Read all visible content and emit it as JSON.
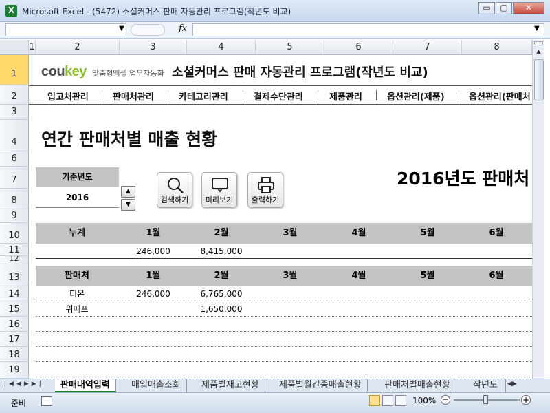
{
  "window": {
    "title": "Microsoft Excel - (5472) 소셜커머스 판매 자동관리 프로그램(작년도 비교)",
    "icon": "X",
    "minimize": "▭",
    "restore": "▢",
    "close": "✕"
  },
  "formula_bar": {
    "fx": "fx"
  },
  "columns": [
    "1",
    "2",
    "3",
    "4",
    "5",
    "6",
    "7",
    "8"
  ],
  "rows": [
    "1",
    "2",
    "3",
    "4",
    "6",
    "7",
    "8",
    "9",
    "10",
    "11",
    "12",
    "13",
    "14",
    "15",
    "16",
    "17",
    "18",
    "19"
  ],
  "brand": {
    "cou": "cou",
    "key": "key",
    "sub": "맞춤형엑셀 업무자동화"
  },
  "app_title": "소셜커머스 판매 자동관리 프로그램(작년도 비교)",
  "nav": [
    "입고처관리",
    "판매처관리",
    "카테고리관리",
    "결제수단관리",
    "제품관리",
    "옵션관리(제품)",
    "옵션관리(판매처"
  ],
  "page_title": "연간 판매처별 매출 현황",
  "year": {
    "label": "기준년도",
    "value": "2016",
    "up": "▲",
    "down": "▼"
  },
  "buttons": {
    "search": "검색하기",
    "preview": "미리보기",
    "print": "출력하기"
  },
  "report_title": "2016년도 판매처",
  "summary": {
    "headers": [
      "누계",
      "1월",
      "2월",
      "3월",
      "4월",
      "5월",
      "6월"
    ],
    "values": [
      "",
      "246,000",
      "8,415,000",
      "",
      "",
      "",
      ""
    ]
  },
  "detail": {
    "headers": [
      "판매처",
      "1월",
      "2월",
      "3월",
      "4월",
      "5월",
      "6월"
    ],
    "rows": [
      [
        "티몬",
        "246,000",
        "6,765,000",
        "",
        "",
        "",
        ""
      ],
      [
        "위메프",
        "",
        "1,650,000",
        "",
        "",
        "",
        ""
      ]
    ]
  },
  "sheet_tabs": [
    "판매내역입력",
    "매입매출조회",
    "제품별재고현황",
    "제품별월간종매출현황",
    "판매처별매출현황",
    "작년도"
  ],
  "status": {
    "ready": "준비",
    "zoom": "100%"
  }
}
